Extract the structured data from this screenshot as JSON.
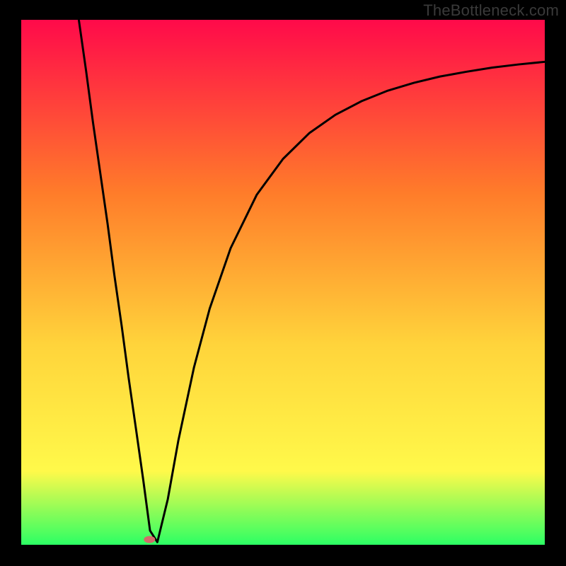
{
  "watermark": "TheBottleneck.com",
  "chart_data": {
    "type": "line",
    "title": "",
    "xlabel": "",
    "ylabel": "",
    "xlim": [
      0,
      100
    ],
    "ylim": [
      0,
      100
    ],
    "grid": false,
    "legend": false,
    "background_gradient": {
      "top": "#ff0a4a",
      "mid1": "#ff7c2a",
      "mid2": "#ffd43b",
      "mid3": "#fff94a",
      "bottom": "#2cff64"
    },
    "annotations": [
      {
        "type": "marker",
        "shape": "ellipse",
        "x": 24.5,
        "y": 1.0,
        "color": "#d46a6a"
      }
    ],
    "series": [
      {
        "name": "curve",
        "color": "#000000",
        "x": [
          11.0,
          12.4,
          13.7,
          15.1,
          16.5,
          17.8,
          19.2,
          20.5,
          21.9,
          23.3,
          24.6,
          26.0,
          28.0,
          30.0,
          33.0,
          36.0,
          40.0,
          45.0,
          50.0,
          55.0,
          60.0,
          65.0,
          70.0,
          75.0,
          80.0,
          85.0,
          90.0,
          95.0,
          100.0
        ],
        "y": [
          100.0,
          90.2,
          80.5,
          70.8,
          61.1,
          51.3,
          41.6,
          31.9,
          22.2,
          12.4,
          2.7,
          0.5,
          8.7,
          19.8,
          33.8,
          45.0,
          56.5,
          66.7,
          73.5,
          78.4,
          81.9,
          84.5,
          86.5,
          88.0,
          89.2,
          90.1,
          90.9,
          91.5,
          92.0
        ]
      }
    ]
  }
}
